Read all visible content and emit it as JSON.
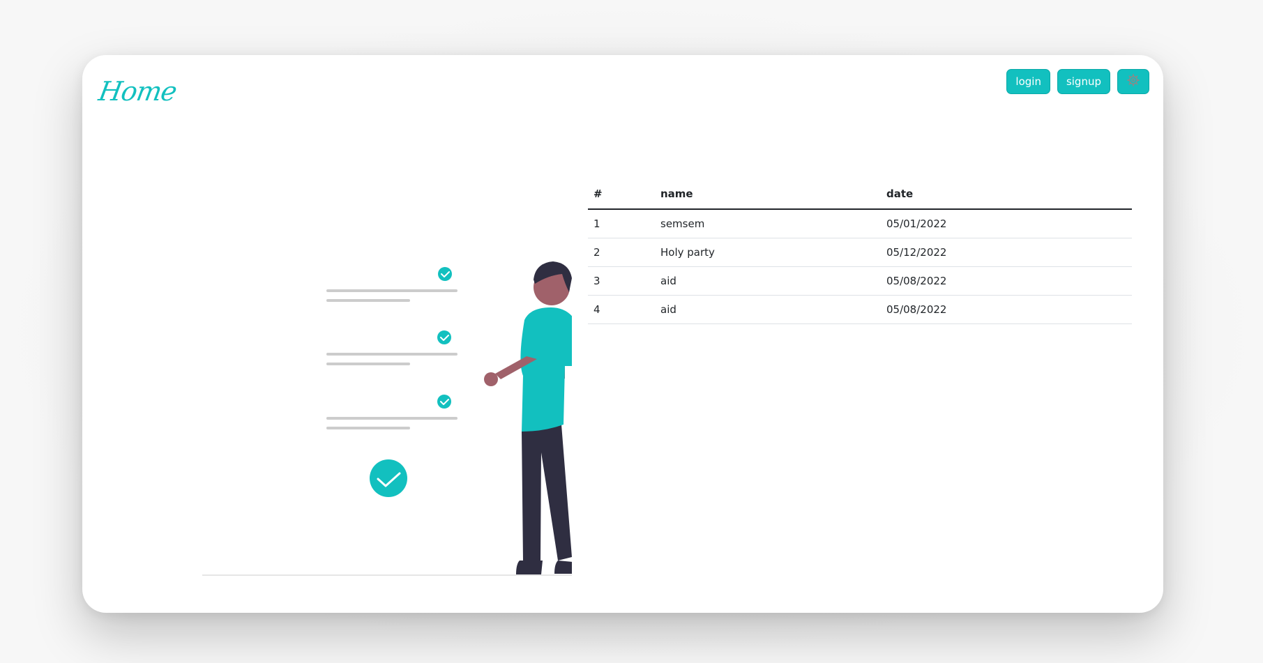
{
  "header": {
    "brand": "Home",
    "buttons": {
      "login": "login",
      "signup": "signup",
      "settings_icon": "gear-icon"
    }
  },
  "colors": {
    "accent": "#12c0bf",
    "dark": "#2f2e41",
    "skin": "#a0616a",
    "line": "#cccccc"
  },
  "table": {
    "columns": [
      "#",
      "name",
      "date"
    ],
    "rows": [
      [
        "1",
        "semsem",
        "05/01/2022"
      ],
      [
        "2",
        "Holy party",
        "05/12/2022"
      ],
      [
        "3",
        "aid",
        "05/08/2022"
      ],
      [
        "4",
        "aid",
        "05/08/2022"
      ]
    ]
  }
}
